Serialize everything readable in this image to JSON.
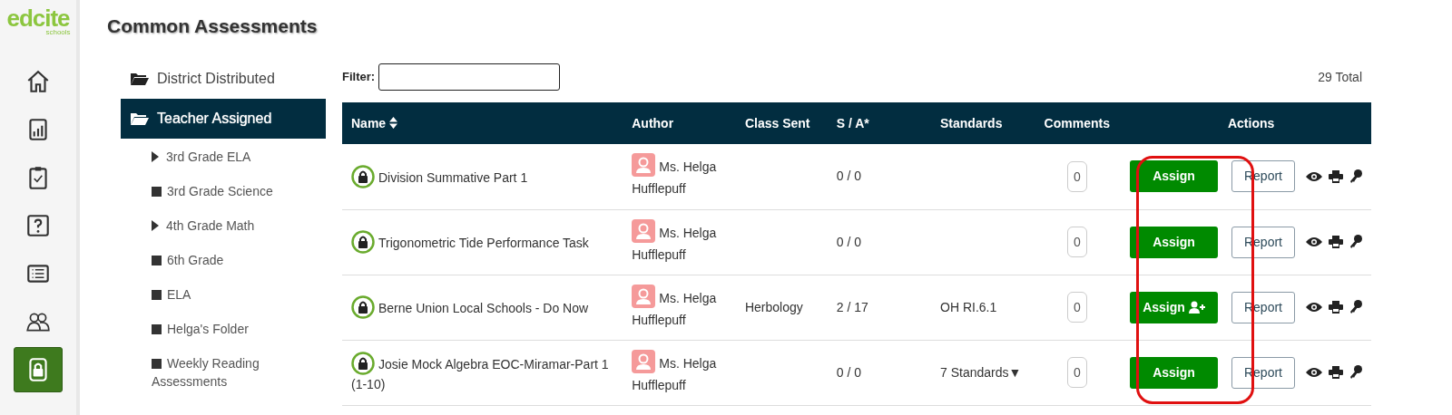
{
  "logo": {
    "word": "edcite",
    "sub": "schools"
  },
  "nav_rail": [
    {
      "kind": "home",
      "selected": false
    },
    {
      "kind": "chart",
      "selected": false
    },
    {
      "kind": "clipboard",
      "selected": false
    },
    {
      "kind": "question",
      "selected": false
    },
    {
      "kind": "list",
      "selected": false
    },
    {
      "kind": "people",
      "selected": false
    },
    {
      "kind": "lock",
      "selected": true
    }
  ],
  "title": "Common Assessments",
  "folders": [
    {
      "label": "District Distributed",
      "selected": false
    },
    {
      "label": "Teacher Assigned",
      "selected": true,
      "children": [
        {
          "label": "3rd Grade ELA",
          "kind": "caret"
        },
        {
          "label": "3rd Grade Science",
          "kind": "square"
        },
        {
          "label": "4th Grade Math",
          "kind": "caret"
        },
        {
          "label": "6th Grade",
          "kind": "square"
        },
        {
          "label": "ELA",
          "kind": "square"
        },
        {
          "label": "Helga's Folder",
          "kind": "square"
        },
        {
          "label": "Weekly Reading Assessments",
          "kind": "square"
        }
      ]
    }
  ],
  "filter": {
    "label": "Filter:"
  },
  "total": "29 Total",
  "table": {
    "columns": [
      "Name",
      "Author",
      "Class Sent",
      "S / A*",
      "Standards",
      "Comments",
      "Actions"
    ],
    "rows": [
      {
        "name": "Division Summative Part 1",
        "author": "Ms. Helga Hufflepuff",
        "sa": "0 / 0",
        "comments": "0",
        "assign": "Assign",
        "assign_icon": false,
        "report": "Report"
      },
      {
        "name": "Trigonometric Tide Performance Task",
        "author": "Ms. Helga Hufflepuff",
        "sa": "0 / 0",
        "comments": "0",
        "assign": "Assign",
        "assign_icon": false,
        "report": "Report"
      },
      {
        "name": "Berne Union Local Schools - Do Now",
        "author": "Ms. Helga Hufflepuff",
        "class_sent": "Herbology",
        "sa": "2 / 17",
        "standards": "OH RI.6.1",
        "comments": "0",
        "assign": "Assign",
        "assign_icon": true,
        "report": "Report"
      },
      {
        "name": "Josie Mock Algebra EOC-Miramar-Part 1 (1-10)",
        "author": "Ms. Helga Hufflepuff",
        "sa": "0 / 0",
        "standards": "7 Standards▼",
        "comments": "0",
        "assign": "Assign",
        "assign_icon": false,
        "report": "Report"
      }
    ]
  },
  "highlight": {
    "kind": "outline"
  }
}
